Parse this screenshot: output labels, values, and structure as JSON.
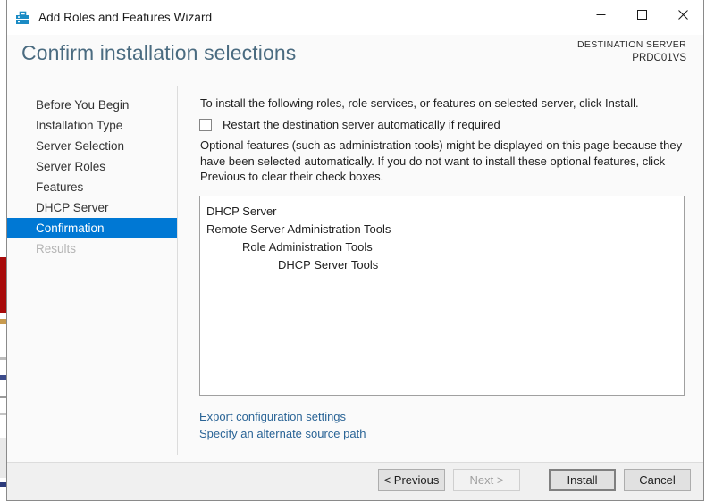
{
  "window": {
    "title": "Add Roles and Features Wizard",
    "icon": "server-tools-icon",
    "controls": {
      "minimize": "minimize-icon",
      "maximize": "maximize-icon",
      "close": "close-icon"
    }
  },
  "header": {
    "page_title": "Confirm installation selections",
    "destination_label": "DESTINATION SERVER",
    "destination_value": "PRDC01VS"
  },
  "sidebar": {
    "items": [
      {
        "label": "Before You Begin",
        "state": "normal"
      },
      {
        "label": "Installation Type",
        "state": "normal"
      },
      {
        "label": "Server Selection",
        "state": "normal"
      },
      {
        "label": "Server Roles",
        "state": "normal"
      },
      {
        "label": "Features",
        "state": "normal"
      },
      {
        "label": "DHCP Server",
        "state": "normal"
      },
      {
        "label": "Confirmation",
        "state": "selected"
      },
      {
        "label": "Results",
        "state": "disabled"
      }
    ]
  },
  "main": {
    "intro_text": "To install the following roles, role services, or features on selected server, click Install.",
    "restart_checkbox": {
      "label": "Restart the destination server automatically if required",
      "checked": false
    },
    "optional_features_text": "Optional features (such as administration tools) might be displayed on this page because they have been selected automatically. If you do not want to install these optional features, click Previous to clear their check boxes.",
    "selections": [
      {
        "label": "DHCP Server",
        "indent": 0
      },
      {
        "label": "Remote Server Administration Tools",
        "indent": 1
      },
      {
        "label": "Role Administration Tools",
        "indent": 2
      },
      {
        "label": "DHCP Server Tools",
        "indent": 3
      }
    ],
    "links": [
      {
        "label": "Export configuration settings"
      },
      {
        "label": "Specify an alternate source path"
      }
    ]
  },
  "footer": {
    "previous_label": "< Previous",
    "next_label": "Next >",
    "install_label": "Install",
    "cancel_label": "Cancel"
  },
  "colors": {
    "accent": "#0078d4",
    "title": "#4a6b80",
    "link": "#2a6496",
    "backdrop_red": "#a80a0a"
  }
}
